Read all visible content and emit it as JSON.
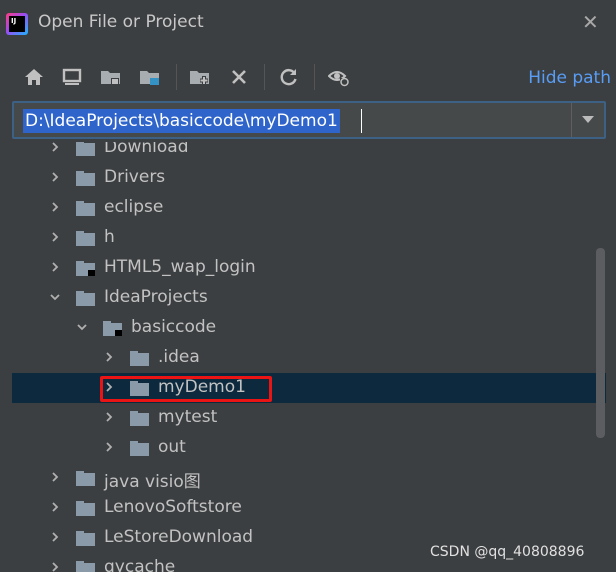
{
  "window": {
    "title": "Open File or Project",
    "close_icon": "close-icon"
  },
  "toolbar": {
    "icons": [
      "home-icon",
      "desktop-icon",
      "project-folder-icon",
      "module-folder-icon",
      "new-folder-icon",
      "delete-icon",
      "refresh-icon",
      "show-hidden-icon"
    ],
    "hide_path_label": "Hide path"
  },
  "path": {
    "value": "D:\\IdeaProjects\\basiccode\\myDemo1"
  },
  "tree": {
    "items": [
      {
        "label": "Download",
        "level": 0,
        "expanded": false
      },
      {
        "label": "Drivers",
        "level": 0,
        "expanded": false
      },
      {
        "label": "eclipse",
        "level": 0,
        "expanded": false
      },
      {
        "label": "h",
        "level": 0,
        "expanded": false
      },
      {
        "label": "HTML5_wap_login",
        "level": 0,
        "expanded": false,
        "project": true
      },
      {
        "label": "IdeaProjects",
        "level": 0,
        "expanded": true
      },
      {
        "label": "basiccode",
        "level": 1,
        "expanded": true,
        "project": true
      },
      {
        "label": ".idea",
        "level": 2,
        "expanded": false
      },
      {
        "label": "myDemo1",
        "level": 2,
        "expanded": false,
        "selected": true,
        "highlighted": true
      },
      {
        "label": "mytest",
        "level": 2,
        "expanded": false
      },
      {
        "label": "out",
        "level": 2,
        "expanded": false
      },
      {
        "label": "java visio图",
        "level": 0,
        "expanded": false
      },
      {
        "label": "LenovoSoftstore",
        "level": 0,
        "expanded": false
      },
      {
        "label": "LeStoreDownload",
        "level": 0,
        "expanded": false
      },
      {
        "label": "qycache",
        "level": 0,
        "expanded": false
      }
    ]
  },
  "watermark": "CSDN @qq_40808896",
  "colors": {
    "accent": "#589df6",
    "selection": "#0d293e",
    "highlight_box": "#ea1414",
    "path_selection": "#2f65ca"
  }
}
